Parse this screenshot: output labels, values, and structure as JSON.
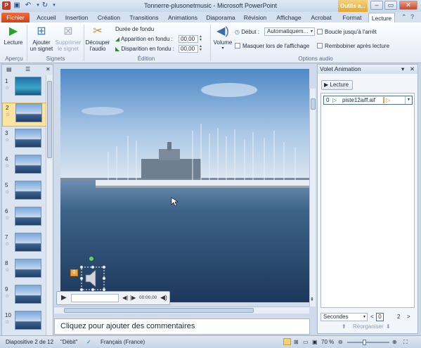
{
  "window": {
    "title": "Tonnerre-plusonetmusic - Microsoft PowerPoint",
    "contextual_tab": "Outils a...",
    "minimize": "–",
    "restore": "▭",
    "close": "✕"
  },
  "tabs": {
    "fichier": "Fichier",
    "accueil": "Accueil",
    "insertion": "Insertion",
    "creation": "Création",
    "transitions": "Transitions",
    "animations": "Animations",
    "diaporama": "Diaporama",
    "revision": "Révision",
    "affichage": "Affichage",
    "acrobat": "Acrobat",
    "format": "Format",
    "lecture": "Lecture"
  },
  "ribbon": {
    "lecture_button": "Lecture",
    "apercu_group": "Aperçu",
    "ajouter_signet_line1": "Ajouter",
    "ajouter_signet_line2": "un signet",
    "supprimer_signet_line1": "Supprimer",
    "supprimer_signet_line2": "le signet",
    "signets_group": "Signets",
    "decouper_line1": "Découper",
    "decouper_line2": "l'audio",
    "duree_fondu": "Durée de fondu",
    "apparition_label": "Apparition en fondu :",
    "apparition_value": "00,00",
    "disparition_label": "Disparition en fondu :",
    "disparition_value": "00,00",
    "edition_group": "Édition",
    "volume_button": "Volume",
    "debut_label": "Début :",
    "debut_value": "Automatiquem...",
    "masquer_label": "Masquer lors de l'affichage",
    "boucle_label": "Boucle jusqu'à l'arrêt",
    "rembobiner_label": "Rembobiner après lecture",
    "options_audio_group": "Options audio"
  },
  "slides": {
    "numbers": [
      "1",
      "2",
      "3",
      "4",
      "5",
      "6",
      "7",
      "8",
      "9",
      "10"
    ],
    "selected_index": 2
  },
  "editor": {
    "audio_bookmark": "0",
    "time": "00:00,00",
    "notes_placeholder": "Cliquez pour ajouter des commentaires"
  },
  "anim_pane": {
    "title": "Volet Animation",
    "play_button": "Lecture",
    "item_number": "0",
    "item_name": "piste12aiff.aif",
    "timing_label": "Secondes",
    "timing_start": "0",
    "timing_end": "2",
    "reorganiser": "Réorganiser"
  },
  "status": {
    "slide_info": "Diapositive 2 de 12",
    "theme": "\"Débit\"",
    "language": "Français (France)",
    "zoom": "70 %"
  }
}
